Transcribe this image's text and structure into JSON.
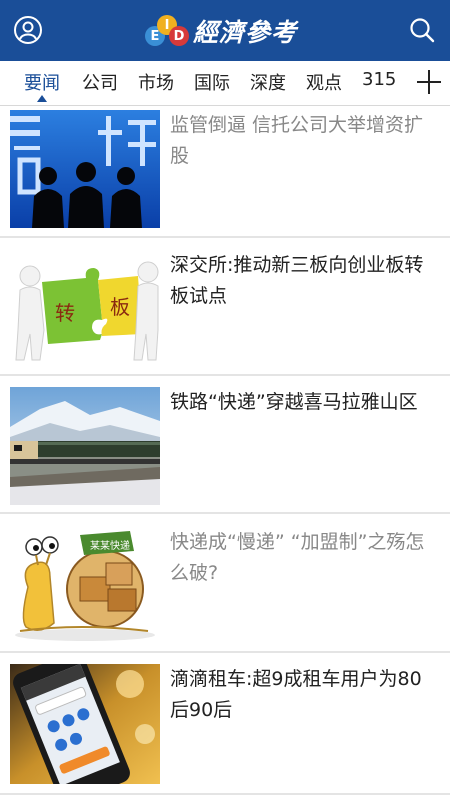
{
  "header": {
    "logo_badges": [
      "E",
      "I",
      "D"
    ],
    "logo_text": "經濟參考",
    "left_icon": "user-icon",
    "right_icon": "search-icon"
  },
  "tabs": [
    {
      "label": "要闻",
      "active": true
    },
    {
      "label": "公司",
      "active": false
    },
    {
      "label": "市场",
      "active": false
    },
    {
      "label": "国际",
      "active": false
    },
    {
      "label": "深度",
      "active": false
    },
    {
      "label": "观点",
      "active": false
    },
    {
      "label": "315",
      "active": false
    }
  ],
  "add_icon": "plus-icon",
  "articles": [
    {
      "title": "监管倒逼 信托公司大举增资扩股",
      "read": true,
      "image": "trust-silhouettes-image"
    },
    {
      "title": "深交所:推动新三板向创业板转板试点",
      "read": false,
      "image": "puzzle-figures-image"
    },
    {
      "title": "铁路“快递”穿越喜马拉雅山区",
      "read": false,
      "image": "train-mountains-image"
    },
    {
      "title": "快递成“慢递” “加盟制”之殇怎么破?",
      "read": true,
      "image": "snail-courier-image"
    },
    {
      "title": "滴滴租车:超9成租车用户为80后90后",
      "read": false,
      "image": "phone-app-image"
    }
  ],
  "colors": {
    "brand": "#1a4e98",
    "read_text": "#888888",
    "unread_text": "#222222",
    "separator": "#e4e4e4"
  }
}
